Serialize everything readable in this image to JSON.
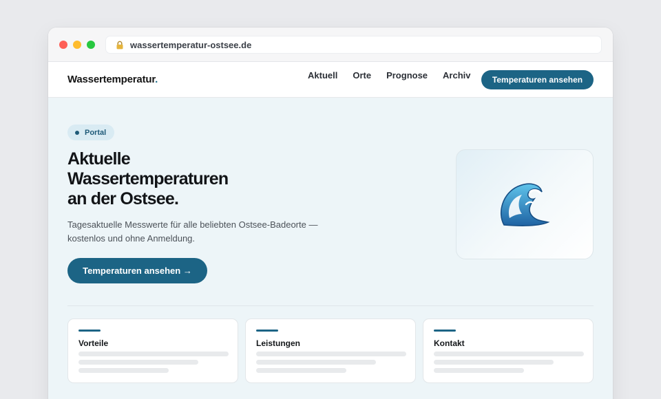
{
  "browser": {
    "url": "wassertemperatur-ostsee.de"
  },
  "nav": {
    "brand": "Wassertemperatur",
    "brand_suffix": ".",
    "links": [
      "Aktuell",
      "Orte",
      "Prognose",
      "Archiv"
    ],
    "cta": "Temperaturen ansehen"
  },
  "hero": {
    "badge": "Portal",
    "headline_line1": "Aktuelle",
    "headline_line2": "Wassertemperaturen",
    "headline_line3": "an der Ostsee.",
    "lead_line1": "Tagesaktuelle Messwerte für alle beliebten Ostsee-Badeorte —",
    "lead_line2": "kostenlos und ohne Anmeldung.",
    "cta": "Temperaturen ansehen →",
    "image_icon": "wave-icon"
  },
  "cards": [
    {
      "title": "Vorteile"
    },
    {
      "title": "Leistungen"
    },
    {
      "title": "Kontakt"
    }
  ],
  "colors": {
    "accent": "#1c6485",
    "hero_bg": "#edf5f8",
    "badge_bg": "#d9ebf3"
  }
}
